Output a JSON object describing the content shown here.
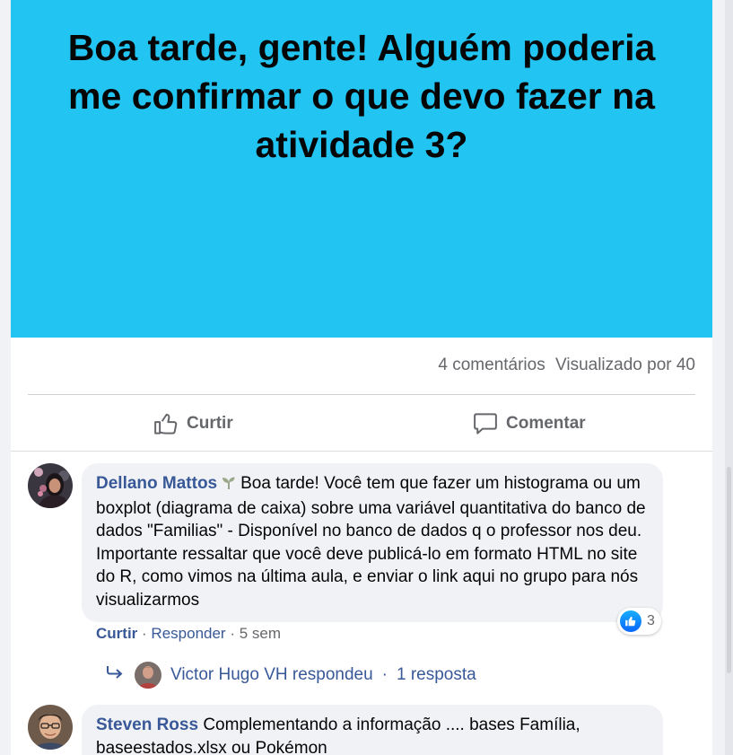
{
  "post": {
    "text": "Boa tarde, gente! Alguém poderia me confirmar o que devo fazer na atividade 3?",
    "background_color": "#22c5f2"
  },
  "stats": {
    "comments": "4 comentários",
    "views": "Visualizado por 40"
  },
  "actions": {
    "like_label": "Curtir",
    "comment_label": "Comentar"
  },
  "comments": [
    {
      "author": "Dellano Mattos",
      "badge_icon": "plant-icon",
      "text": "Boa tarde! Você tem que fazer um histograma ou um boxplot (diagrama de caixa) sobre uma variável quantitativa do banco de dados \"Familias\" - Disponível no banco de dados q o professor nos deu. Importante ressaltar que você deve publicá-lo em formato HTML no site do R, como vimos na última aula, e enviar o link aqui no grupo para nós visualizarmos",
      "reaction_count": "3",
      "like_label": "Curtir",
      "reply_label": "Responder",
      "separator": "·",
      "time": "5 sem",
      "replies_summary": {
        "replier": "Victor Hugo VH respondeu",
        "separator": "·",
        "count": "1 resposta"
      }
    },
    {
      "author": "Steven Ross",
      "text": "Complementando a informação .... bases Família, baseestados.xlsx ou Pokémon"
    }
  ]
}
